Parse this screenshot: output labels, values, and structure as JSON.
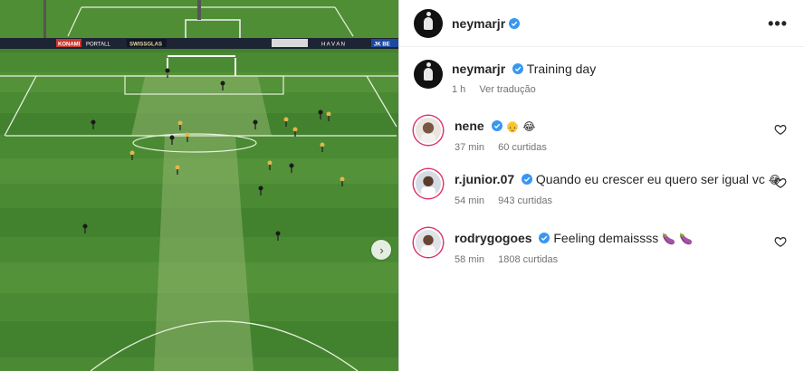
{
  "post": {
    "author": "neymarjr",
    "caption": "Training day",
    "time": "1 h",
    "translate_label": "Ver tradução"
  },
  "header": {
    "username": "neymarjr",
    "more_label": "•••"
  },
  "media": {
    "next_label": "›",
    "pitch_ads": [
      "KONAMI",
      "PORTALL",
      "SWISSGLAS",
      "H A V A N",
      "JK BE"
    ]
  },
  "comments": [
    {
      "username": "nene",
      "text": "",
      "emojis": [
        "👴",
        "😂"
      ],
      "time": "37 min",
      "likes": "60 curtidas"
    },
    {
      "username": "r.junior.07",
      "text": "Quando eu crescer eu quero ser igual vc",
      "emojis": [
        "😂"
      ],
      "time": "54 min",
      "likes": "943 curtidas"
    },
    {
      "username": "rodrygogoes",
      "text": "Feeling demaissss",
      "emojis": [
        "🍆",
        "🍆"
      ],
      "time": "58 min",
      "likes": "1808 curtidas"
    }
  ],
  "colors": {
    "verified": "#3897f0",
    "muted_text": "#737373",
    "pitch_dark": "#3d7a2b",
    "pitch_light": "#5c9a3c",
    "gold_kit": "#e2b64a"
  }
}
